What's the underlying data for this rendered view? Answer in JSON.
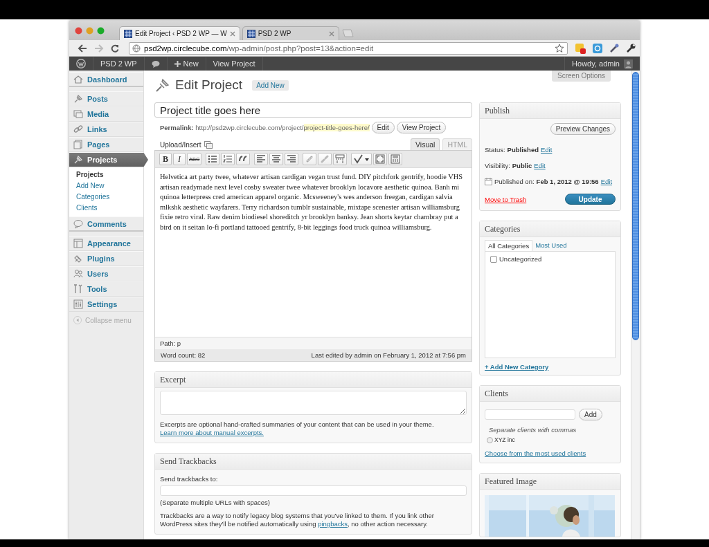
{
  "browser": {
    "tabs": [
      {
        "title": "Edit Project ‹ PSD 2 WP — W",
        "selected": true
      },
      {
        "title": "PSD 2 WP",
        "selected": false
      }
    ],
    "url": {
      "host": "psd2wp.circlecube.com",
      "path": "/wp-admin/post.php?post=13&action=edit"
    }
  },
  "admin_bar": {
    "site": "PSD 2 WP",
    "new": "New",
    "view": "View Project",
    "greeting": "Howdy, admin"
  },
  "sidebar": {
    "items": [
      {
        "label": "Dashboard",
        "selected": false,
        "separator_after": true
      },
      {
        "label": "Posts",
        "selected": false,
        "separator_after": false
      },
      {
        "label": "Media",
        "selected": false,
        "separator_after": false
      },
      {
        "label": "Links",
        "selected": false,
        "separator_after": false
      },
      {
        "label": "Pages",
        "selected": false,
        "separator_after": false
      },
      {
        "label": "Projects",
        "selected": true,
        "separator_after": false,
        "children": [
          {
            "label": "Projects",
            "selected": true
          },
          {
            "label": "Add New",
            "selected": false
          },
          {
            "label": "Categories",
            "selected": false
          },
          {
            "label": "Clients",
            "selected": false
          }
        ]
      },
      {
        "label": "Comments",
        "selected": false,
        "separator_after": true
      },
      {
        "label": "Appearance",
        "selected": false,
        "separator_after": false
      },
      {
        "label": "Plugins",
        "selected": false,
        "separator_after": false
      },
      {
        "label": "Users",
        "selected": false,
        "separator_after": false
      },
      {
        "label": "Tools",
        "selected": false,
        "separator_after": false
      },
      {
        "label": "Settings",
        "selected": false,
        "separator_after": false
      }
    ],
    "collapse": "Collapse menu"
  },
  "screen_options": "Screen Options",
  "heading": {
    "title": "Edit Project",
    "add_new": "Add New"
  },
  "title_field": {
    "value": "Project title goes here"
  },
  "permalink": {
    "label": "Permalink:",
    "base": "http://psd2wp.circlecube.com/project/",
    "slug": "project-title-goes-here/",
    "buttons": [
      "Edit",
      "View Project"
    ]
  },
  "editor": {
    "upload_label": "Upload/Insert",
    "tabs": [
      {
        "label": "Visual",
        "selected": true
      },
      {
        "label": "HTML",
        "selected": false
      }
    ],
    "toolbar": {
      "bold": "B",
      "italic": "I",
      "strike": "ABC"
    },
    "content": "Helvetica art party twee, whatever artisan cardigan vegan trust fund. DIY pitchfork gentrify, hoodie VHS artisan readymade next level cosby sweater twee whatever brooklyn locavore aesthetic quinoa. Banh mi quinoa letterpress cred american apparel organic. Mcsweeney's wes anderson freegan, cardigan salvia mlkshk aesthetic wayfarers. Terry richardson tumblr sustainable, mixtape scenester artisan williamsburg fixie retro viral. Raw denim biodiesel shoreditch yr brooklyn banksy. Jean shorts keytar chambray put a bird on it seitan lo-fi portland tattooed gentrify, 8-bit leggings food truck quinoa williamsburg.",
    "path": "Path: p",
    "word_count": "Word count: 82",
    "last_edited": "Last edited by admin on February 1, 2012 at 7:56 pm"
  },
  "excerpt": {
    "title": "Excerpt",
    "help": "Excerpts are optional hand-crafted summaries of your content that can be used in your theme. ",
    "link": "Learn more about manual excerpts."
  },
  "trackbacks": {
    "title": "Send Trackbacks",
    "label": "Send trackbacks to:",
    "hint": "(Separate multiple URLs with spaces)",
    "text_before": "Trackbacks are a way to notify legacy blog systems that you've linked to them. If you link other WordPress sites they'll be notified automatically using ",
    "link": "pingbacks",
    "text_after": ", no other action necessary."
  },
  "publish": {
    "title": "Publish",
    "preview": "Preview Changes",
    "rows": [
      {
        "label": "Status:",
        "value": "Published",
        "link": "Edit"
      },
      {
        "label": "Visibility:",
        "value": "Public",
        "link": "Edit"
      },
      {
        "kind": "date",
        "label": "Published on:",
        "value": "Feb 1, 2012 @ 19:56",
        "link": "Edit"
      }
    ],
    "trash": "Move to Trash",
    "update": "Update"
  },
  "categories": {
    "title": "Categories",
    "tabs": [
      {
        "label": "All Categories",
        "selected": true
      },
      {
        "label": "Most Used",
        "selected": false
      }
    ],
    "items": [
      {
        "label": "Uncategorized",
        "checked": false
      }
    ],
    "add_link": "+ Add New Category"
  },
  "clients": {
    "title": "Clients",
    "add": "Add",
    "hint": "Separate clients with commas",
    "tags": [
      {
        "label": "XYZ inc"
      }
    ],
    "link": "Choose from the most used clients"
  },
  "featured": {
    "title": "Featured Image"
  }
}
